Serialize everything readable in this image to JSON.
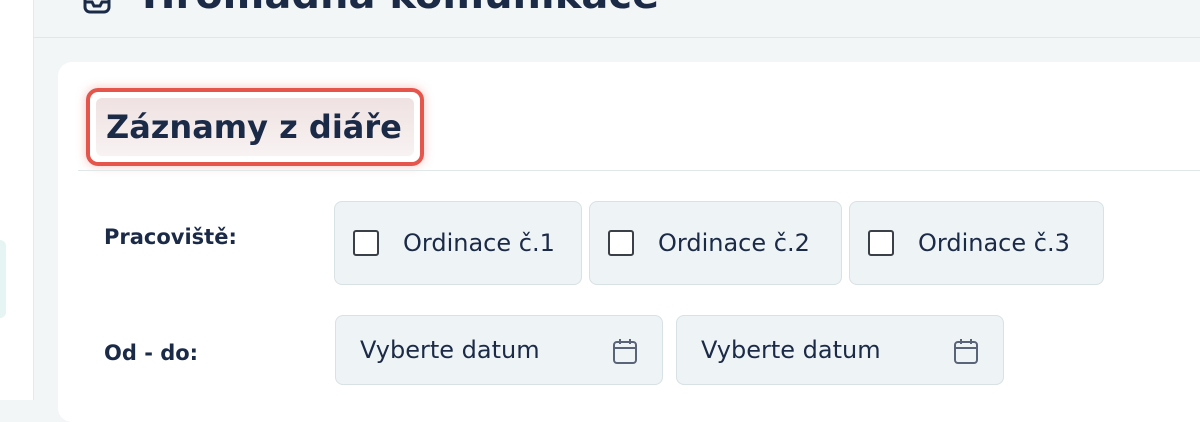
{
  "header": {
    "title": "Hromadná komunikace",
    "icon": "inbox-icon"
  },
  "sidebar": {
    "icon": "panel-icon"
  },
  "section": {
    "title": "Záznamy z diáře"
  },
  "filters": {
    "workplace_label": "Pracoviště:",
    "workplaces": [
      {
        "label": "Ordinace č.1",
        "checked": false
      },
      {
        "label": "Ordinace č.2",
        "checked": false
      },
      {
        "label": "Ordinace č.3",
        "checked": false
      }
    ],
    "date_label": "Od - do:",
    "date_from_placeholder": "Vyberte datum",
    "date_to_placeholder": "Vyberte datum"
  },
  "colors": {
    "highlight": "#e5554c",
    "text": "#1b2a47",
    "field_bg": "#eef3f5"
  }
}
